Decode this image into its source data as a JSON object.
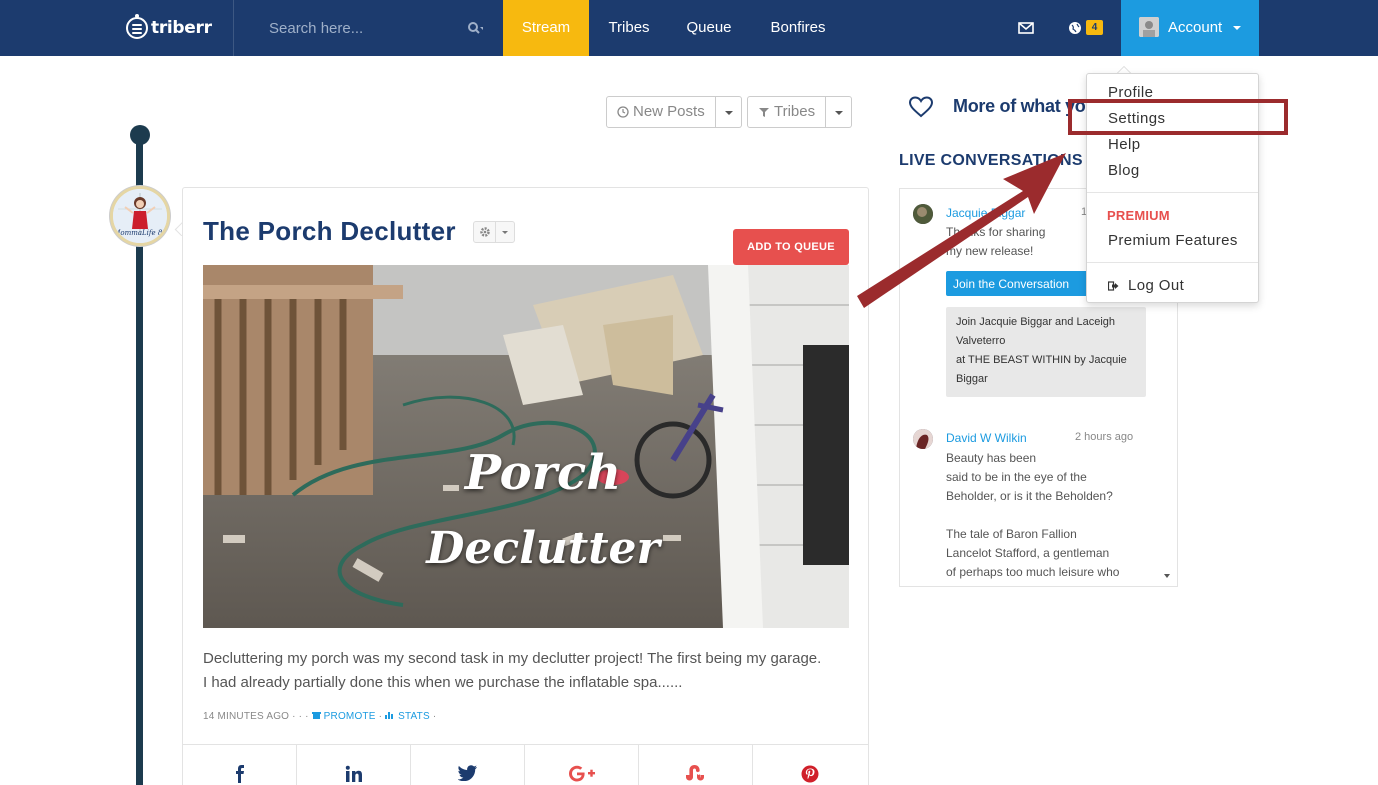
{
  "navbar": {
    "logo_text": "triberr",
    "search_placeholder": "Search here...",
    "links": {
      "stream": "Stream",
      "tribes": "Tribes",
      "queue": "Queue",
      "bonfires": "Bonfires"
    },
    "notification_count": "4",
    "account_label": "Account"
  },
  "filters": {
    "new_posts": "New Posts",
    "tribes": "Tribes"
  },
  "post": {
    "title": "The Porch Declutter",
    "add_to_queue": "ADD TO QUEUE",
    "image_text_line1": "Porch",
    "image_text_line2": "Declutter",
    "excerpt": "Decluttering my porch was my second task in my declutter project! The first being my garage. I had already partially done this when we purchase the inflatable spa......",
    "meta": {
      "time": "14 MINUTES AGO",
      "separator": "· · ·",
      "promote": "PROMOTE",
      "dot": "·",
      "stats": "STATS",
      "dot_end": "·"
    },
    "avatar_caption": "MommaLife 82"
  },
  "sidebar": {
    "more_title": "More of what you",
    "live_title": "LIVE CONVERSATIONS",
    "conversations": [
      {
        "name": "Jacquie Biggar",
        "time": "1",
        "text_line1": "Thanks for sharing",
        "text_line2": "my new release!",
        "join_button": "Join the Conversation",
        "join_text_line1": "Join Jacquie Biggar and Laceigh",
        "join_text_line2": "Valveterro",
        "join_text_line3": "at THE BEAST WITHIN by Jacquie",
        "join_text_line4": "Biggar"
      },
      {
        "name": "David W Wilkin",
        "time": "2 hours ago",
        "text_line1": "Beauty has been",
        "text_line2": "said to be in the eye of the",
        "text_line3": "Beholder, or is it the Beholden?",
        "text_line4": "The tale of Baron Fallion",
        "text_line5": "Lancelot Stafford, a gentleman",
        "text_line6": "of perhaps too much leisure who"
      }
    ]
  },
  "dropdown": {
    "profile": "Profile",
    "settings": "Settings",
    "help": "Help",
    "blog": "Blog",
    "premium_heading": "PREMIUM",
    "premium_features": "Premium Features",
    "log_out": "Log Out"
  },
  "colors": {
    "navbar": "#1c3b6e",
    "stream_active": "#f7b90f",
    "account_active": "#1c9be0",
    "add_to_queue": "#e7504e",
    "annotation": "#9b2b2d"
  }
}
